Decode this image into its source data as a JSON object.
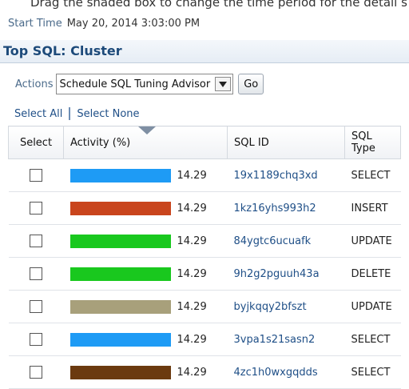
{
  "hint": "Drag the shaded box to change the time period for the detail s",
  "start_time": {
    "label": "Start Time",
    "value": "May 20, 2014 3:03:00 PM"
  },
  "title": "Top SQL: Cluster",
  "actions": {
    "label": "Actions",
    "selected": "Schedule SQL Tuning Advisor",
    "go_label": "Go"
  },
  "links": {
    "select_all": "Select All",
    "select_none": "Select None"
  },
  "columns": {
    "select": "Select",
    "activity": "Activity (%)",
    "sql_id": "SQL ID",
    "sql_type": "SQL Type"
  },
  "rows": [
    {
      "activity": "14.29",
      "sql_id": "19x1189chq3xd",
      "sql_type": "SELECT",
      "color": "#1e9bf5"
    },
    {
      "activity": "14.29",
      "sql_id": "1kz16yhs993h2",
      "sql_type": "INSERT",
      "color": "#c9451d"
    },
    {
      "activity": "14.29",
      "sql_id": "84ygtc6ucuafk",
      "sql_type": "UPDATE",
      "color": "#19c81e"
    },
    {
      "activity": "14.29",
      "sql_id": "9h2g2pguuh43a",
      "sql_type": "DELETE",
      "color": "#19c81e"
    },
    {
      "activity": "14.29",
      "sql_id": "byjkqqy2bfszt",
      "sql_type": "UPDATE",
      "color": "#a8a07b"
    },
    {
      "activity": "14.29",
      "sql_id": "3vpa1s21sasn2",
      "sql_type": "SELECT",
      "color": "#1e9bf5"
    },
    {
      "activity": "14.29",
      "sql_id": "4zc1h0wxgqdds",
      "sql_type": "SELECT",
      "color": "#6b3a0f"
    }
  ]
}
